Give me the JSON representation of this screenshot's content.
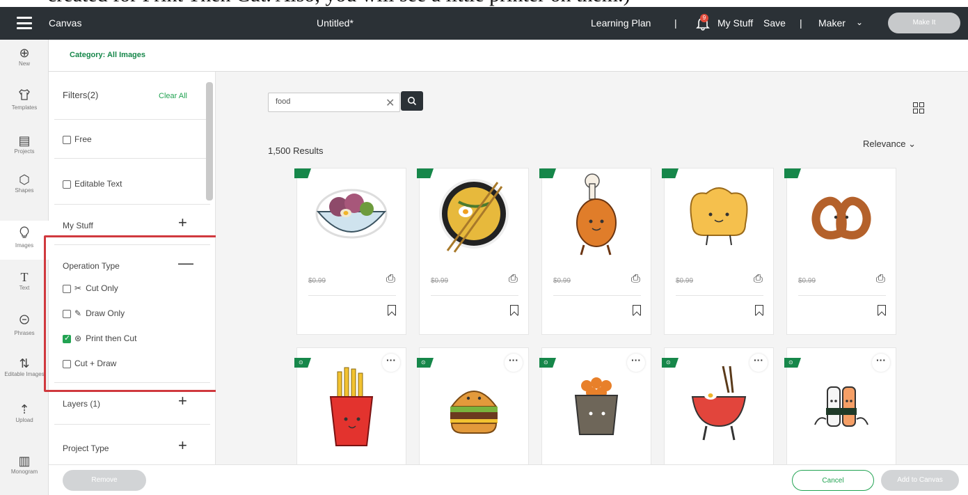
{
  "caption": {
    "text": "created for Print Then Cut. Also, you will see a little printer on them.)"
  },
  "topbar": {
    "app_name": "Canvas",
    "doc_title": "Untitled*",
    "learning_plan": "Learning Plan",
    "separator": "|",
    "my_stuff": "My Stuff",
    "save": "Save",
    "machine": "Maker",
    "make_it": "Make It",
    "notification_count": "9"
  },
  "rail": {
    "items": [
      {
        "label": "New",
        "icon": "plus-circle-icon",
        "glyph": "⊕"
      },
      {
        "label": "Templates",
        "icon": "shirt-icon",
        "glyph": "⚲"
      },
      {
        "label": "Projects",
        "icon": "projects-icon",
        "glyph": "▤"
      },
      {
        "label": "Shapes",
        "icon": "shapes-icon",
        "glyph": "⬡"
      },
      {
        "label": "Images",
        "icon": "lightbulb-icon",
        "glyph": "♀"
      },
      {
        "label": "Text",
        "icon": "text-icon",
        "glyph": "T"
      },
      {
        "label": "Phrases",
        "icon": "speech-bubble-icon",
        "glyph": "☺"
      },
      {
        "label": "Editable Images",
        "icon": "editable-image-icon",
        "glyph": "⇅"
      },
      {
        "label": "Upload",
        "icon": "upload-icon",
        "glyph": "⇡"
      },
      {
        "label": "Monogram",
        "icon": "monogram-icon",
        "glyph": "▥"
      }
    ]
  },
  "category": "Category: All Images",
  "filters": {
    "title": "Filters(2)",
    "clear_all": "Clear All",
    "free": "Free",
    "editable_text": "Editable Text",
    "my_stuff": "My Stuff",
    "operation_type": "Operation Type",
    "cut_only": "Cut Only",
    "draw_only": "Draw Only",
    "print_then_cut": "Print then Cut",
    "cut_draw": "Cut + Draw",
    "layers": "Layers (1)",
    "project_type": "Project Type"
  },
  "search": {
    "value": "food"
  },
  "results": "1,500 Results",
  "sort": "Relevance",
  "cards_row1": [
    {
      "name": "salad bowl",
      "price": "$0.99"
    },
    {
      "name": "ramen bowl",
      "price": "$0.99"
    },
    {
      "name": "drumstick",
      "price": "$0.99"
    },
    {
      "name": "toast",
      "price": "$0.99"
    },
    {
      "name": "pretzel",
      "price": "$0.99"
    }
  ],
  "cards_row2": [
    {
      "name": "fries"
    },
    {
      "name": "burger"
    },
    {
      "name": "sushi bowl"
    },
    {
      "name": "noodle bowl"
    },
    {
      "name": "sushi roll"
    }
  ],
  "footer": {
    "remove": "Remove",
    "cancel": "Cancel",
    "add_to_canvas": "Add to Canvas"
  },
  "colors": {
    "accent": "#22a352",
    "topbar": "#2b3136",
    "highlight": "#d0393e"
  }
}
